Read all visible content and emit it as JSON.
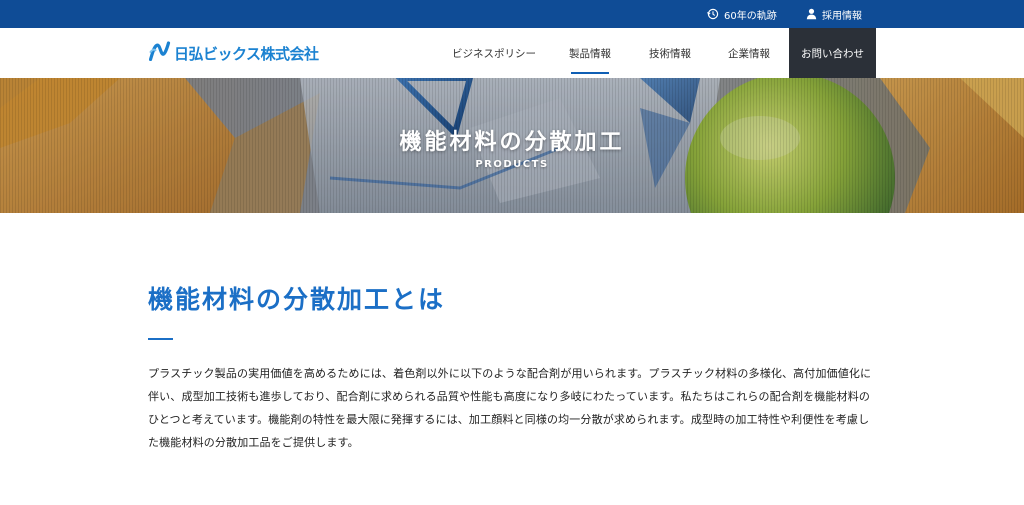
{
  "topbar": {
    "history_label": "60年の軌跡",
    "history_icon": "history-clock-icon",
    "recruit_label": "採用情報",
    "recruit_icon": "person-icon"
  },
  "header": {
    "logo_text": "日弘ビックス株式会社",
    "nav": {
      "policy": "ビジネスポリシー",
      "products": "製品情報",
      "tech": "技術情報",
      "company": "企業情報",
      "contact": "お問い合わせ"
    },
    "active_nav": "products"
  },
  "hero": {
    "title": "機能材料の分散加工",
    "subtitle": "PRODUCTS"
  },
  "main": {
    "heading": "機能材料の分散加工とは",
    "body": "プラスチック製品の実用価値を高めるためには、着色剤以外に以下のような配合剤が用いられます。プラスチック材料の多様化、高付加価値化に伴い、成型加工技術も進歩しており、配合剤に求められる品質や性能も高度になり多岐にわたっています。私たちはこれらの配合剤を機能材料のひとつと考えています。機能剤の特性を最大限に発揮するには、加工顔料と同様の均一分散が求められます。成型時の加工特性や利便性を考慮した機能材料の分散加工品をご提供します。"
  },
  "colors": {
    "topbar": "#0f4c96",
    "accent": "#1b6fc6",
    "logo": "#1b82d1",
    "contact_bg": "#2b3038"
  }
}
